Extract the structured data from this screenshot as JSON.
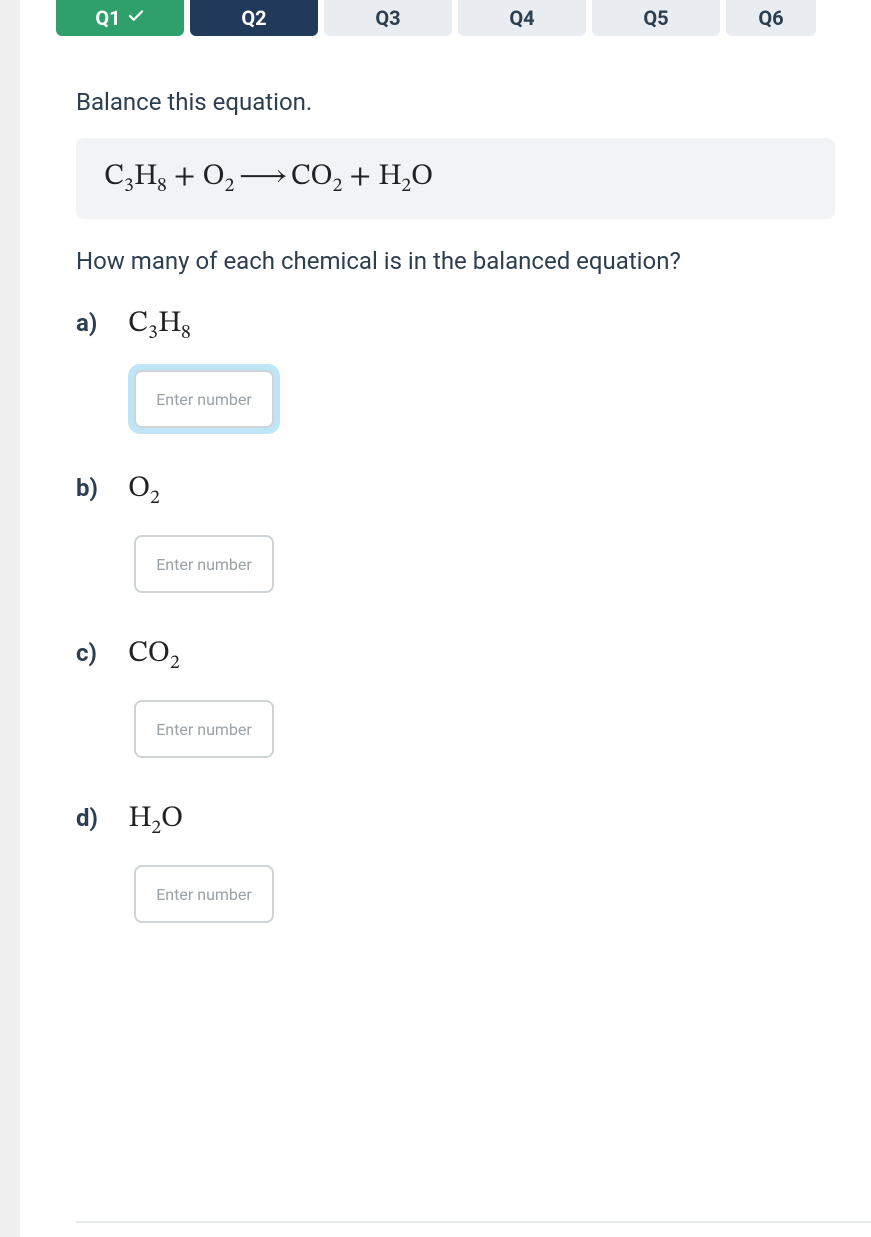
{
  "tabs": [
    {
      "label": "Q1",
      "state": "done"
    },
    {
      "label": "Q2",
      "state": "active"
    },
    {
      "label": "Q3",
      "state": "idle"
    },
    {
      "label": "Q4",
      "state": "idle"
    },
    {
      "label": "Q5",
      "state": "idle"
    },
    {
      "label": "Q6",
      "state": "idle"
    }
  ],
  "prompt": "Balance this equation.",
  "equation": {
    "t1": "C",
    "s1": "3",
    "t2": "H",
    "s2": "8",
    "plus1": " + ",
    "t3": "O",
    "s3": "2",
    "arrow": " ⟶ ",
    "t4": "CO",
    "s4": "2",
    "plus2": " + ",
    "t5": "H",
    "s5": "2",
    "t6": "O"
  },
  "subprompt": "How many of each chemical is in the balanced equation?",
  "input_placeholder": "Enter number",
  "parts": [
    {
      "label": "a)",
      "chem": {
        "a": "C",
        "sa": "3",
        "b": "H",
        "sb": "8",
        "c": "",
        "sc": ""
      },
      "focused": true
    },
    {
      "label": "b)",
      "chem": {
        "a": "O",
        "sa": "2",
        "b": "",
        "sb": "",
        "c": "",
        "sc": ""
      },
      "focused": false
    },
    {
      "label": "c)",
      "chem": {
        "a": "CO",
        "sa": "2",
        "b": "",
        "sb": "",
        "c": "",
        "sc": ""
      },
      "focused": false
    },
    {
      "label": "d)",
      "chem": {
        "a": "H",
        "sa": "2",
        "b": "O",
        "sb": "",
        "c": "",
        "sc": ""
      },
      "focused": false
    }
  ]
}
